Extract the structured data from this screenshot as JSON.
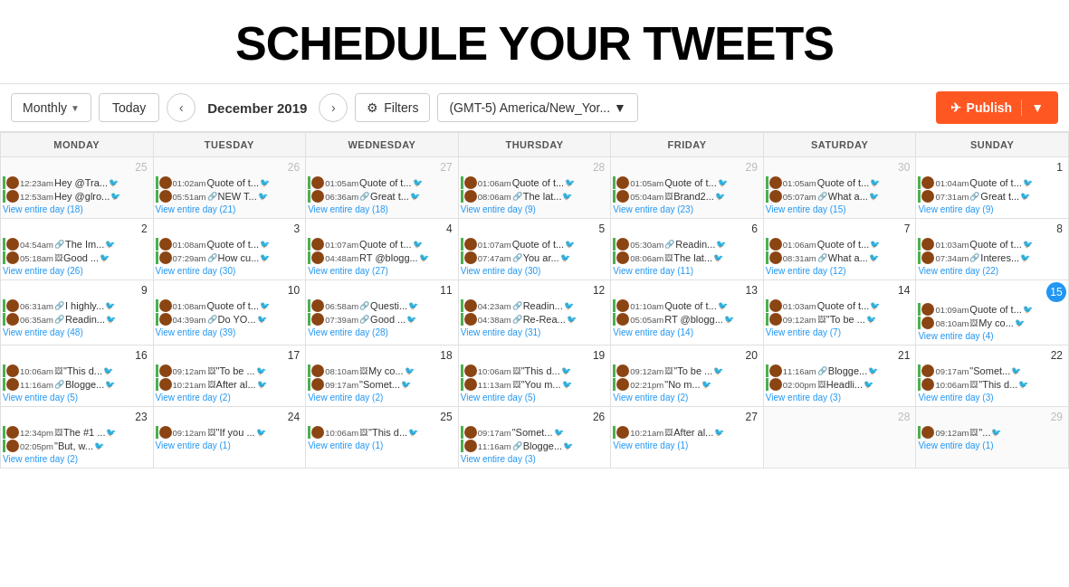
{
  "title": "SCHEDULE YOUR TWEETS",
  "toolbar": {
    "monthly_label": "Monthly",
    "today_label": "Today",
    "prev_icon": "‹",
    "next_icon": "›",
    "date_label": "December 2019",
    "filters_label": "Filters",
    "timezone_label": "(GMT-5) America/New_Yor...",
    "publish_label": "Publish"
  },
  "calendar": {
    "headers": [
      "MONDAY",
      "TUESDAY",
      "WEDNESDAY",
      "THURSDAY",
      "FRIDAY",
      "SATURDAY",
      "SUNDAY"
    ],
    "weeks": [
      {
        "days": [
          {
            "num": "25",
            "other": true,
            "tweets": [
              {
                "time": "12:23am",
                "icon": "",
                "text": "Hey @Tra..."
              },
              {
                "time": "12:53am",
                "icon": "",
                "text": "Hey @glro..."
              }
            ],
            "view": "View entire day (18)"
          },
          {
            "num": "26",
            "other": true,
            "tweets": [
              {
                "time": "01:02am",
                "icon": "",
                "text": "Quote of t..."
              },
              {
                "time": "05:51am",
                "icon": "🔗",
                "text": "NEW T..."
              }
            ],
            "view": "View entire day (21)"
          },
          {
            "num": "27",
            "other": true,
            "tweets": [
              {
                "time": "01:05am",
                "icon": "",
                "text": "Quote of t..."
              },
              {
                "time": "06:36am",
                "icon": "🔗",
                "text": "Great t..."
              }
            ],
            "view": "View entire day (18)"
          },
          {
            "num": "28",
            "other": true,
            "tweets": [
              {
                "time": "01:06am",
                "icon": "",
                "text": "Quote of t..."
              },
              {
                "time": "08:06am",
                "icon": "🔗",
                "text": "The lat..."
              }
            ],
            "view": "View entire day (9)"
          },
          {
            "num": "29",
            "other": true,
            "tweets": [
              {
                "time": "01:05am",
                "icon": "",
                "text": "Quote of t..."
              },
              {
                "time": "05:04am",
                "icon": "🖼",
                "text": "Brand2..."
              }
            ],
            "view": "View entire day (23)"
          },
          {
            "num": "30",
            "other": true,
            "tweets": [
              {
                "time": "01:05am",
                "icon": "",
                "text": "Quote of t..."
              },
              {
                "time": "05:07am",
                "icon": "🔗",
                "text": "What a..."
              }
            ],
            "view": "View entire day (15)"
          },
          {
            "num": "1",
            "other": false,
            "tweets": [
              {
                "time": "01:04am",
                "icon": "",
                "text": "Quote of t..."
              },
              {
                "time": "07:31am",
                "icon": "🔗",
                "text": "Great t..."
              }
            ],
            "view": "View entire day (9)"
          }
        ]
      },
      {
        "days": [
          {
            "num": "2",
            "other": false,
            "tweets": [
              {
                "time": "04:54am",
                "icon": "🔗",
                "text": "The Im..."
              },
              {
                "time": "05:18am",
                "icon": "🖼",
                "text": "Good ..."
              }
            ],
            "view": "View entire day (26)"
          },
          {
            "num": "3",
            "other": false,
            "tweets": [
              {
                "time": "01:08am",
                "icon": "",
                "text": "Quote of t..."
              },
              {
                "time": "07:29am",
                "icon": "🔗",
                "text": "How cu..."
              }
            ],
            "view": "View entire day (30)"
          },
          {
            "num": "4",
            "other": false,
            "tweets": [
              {
                "time": "01:07am",
                "icon": "",
                "text": "Quote of t..."
              },
              {
                "time": "04:48am",
                "icon": "",
                "text": "RT @blogg..."
              }
            ],
            "view": "View entire day (27)"
          },
          {
            "num": "5",
            "other": false,
            "tweets": [
              {
                "time": "01:07am",
                "icon": "",
                "text": "Quote of t..."
              },
              {
                "time": "07:47am",
                "icon": "🔗",
                "text": "You ar..."
              }
            ],
            "view": "View entire day (30)"
          },
          {
            "num": "6",
            "other": false,
            "tweets": [
              {
                "time": "05:30am",
                "icon": "🔗",
                "text": "Readin..."
              },
              {
                "time": "08:06am",
                "icon": "🖼",
                "text": "The lat..."
              }
            ],
            "view": "View entire day (11)"
          },
          {
            "num": "7",
            "other": false,
            "tweets": [
              {
                "time": "01:06am",
                "icon": "",
                "text": "Quote of t..."
              },
              {
                "time": "08:31am",
                "icon": "🔗",
                "text": "What a..."
              }
            ],
            "view": "View entire day (12)"
          },
          {
            "num": "8",
            "other": false,
            "tweets": [
              {
                "time": "01:03am",
                "icon": "",
                "text": "Quote of t..."
              },
              {
                "time": "07:34am",
                "icon": "🔗",
                "text": "Interes..."
              }
            ],
            "view": "View entire day (22)"
          }
        ]
      },
      {
        "days": [
          {
            "num": "9",
            "other": false,
            "tweets": [
              {
                "time": "06:31am",
                "icon": "🔗",
                "text": "I highly..."
              },
              {
                "time": "06:35am",
                "icon": "🔗",
                "text": "Readin..."
              }
            ],
            "view": "View entire day (48)"
          },
          {
            "num": "10",
            "other": false,
            "tweets": [
              {
                "time": "01:08am",
                "icon": "",
                "text": "Quote of t..."
              },
              {
                "time": "04:39am",
                "icon": "🔗",
                "text": "Do YO..."
              }
            ],
            "view": "View entire day (39)"
          },
          {
            "num": "11",
            "other": false,
            "tweets": [
              {
                "time": "06:58am",
                "icon": "🔗",
                "text": "Questi..."
              },
              {
                "time": "07:39am",
                "icon": "🔗",
                "text": "Good ..."
              }
            ],
            "view": "View entire day (28)"
          },
          {
            "num": "12",
            "other": false,
            "tweets": [
              {
                "time": "04:23am",
                "icon": "🔗",
                "text": "Readin..."
              },
              {
                "time": "04:38am",
                "icon": "🔗",
                "text": "Re-Rea..."
              }
            ],
            "view": "View entire day (31)"
          },
          {
            "num": "13",
            "other": false,
            "tweets": [
              {
                "time": "01:10am",
                "icon": "",
                "text": "Quote of t..."
              },
              {
                "time": "05:05am",
                "icon": "",
                "text": "RT @blogg..."
              }
            ],
            "view": "View entire day (14)"
          },
          {
            "num": "14",
            "other": false,
            "tweets": [
              {
                "time": "01:03am",
                "icon": "",
                "text": "Quote of t..."
              },
              {
                "time": "09:12am",
                "icon": "🖼",
                "text": "\"To be ..."
              }
            ],
            "view": "View entire day (7)"
          },
          {
            "num": "15",
            "today": true,
            "other": false,
            "tweets": [
              {
                "time": "01:09am",
                "icon": "",
                "text": "Quote of t..."
              },
              {
                "time": "08:10am",
                "icon": "🖼",
                "text": "My co..."
              }
            ],
            "view": "View entire day (4)"
          }
        ]
      },
      {
        "days": [
          {
            "num": "16",
            "other": false,
            "tweets": [
              {
                "time": "10:06am",
                "icon": "🖼",
                "text": "\"This d..."
              },
              {
                "time": "11:16am",
                "icon": "🔗",
                "text": "Blogge..."
              }
            ],
            "view": "View entire day (5)"
          },
          {
            "num": "17",
            "other": false,
            "tweets": [
              {
                "time": "09:12am",
                "icon": "🖼",
                "text": "\"To be ..."
              },
              {
                "time": "10:21am",
                "icon": "🖼",
                "text": "After al..."
              }
            ],
            "view": "View entire day (2)"
          },
          {
            "num": "18",
            "other": false,
            "tweets": [
              {
                "time": "08:10am",
                "icon": "🖼",
                "text": "My co..."
              },
              {
                "time": "09:17am",
                "icon": "",
                "text": "\"Somet..."
              }
            ],
            "view": "View entire day (2)"
          },
          {
            "num": "19",
            "other": false,
            "tweets": [
              {
                "time": "10:06am",
                "icon": "🖼",
                "text": "\"This d..."
              },
              {
                "time": "11:13am",
                "icon": "🖼",
                "text": "\"You m..."
              }
            ],
            "view": "View entire day (5)"
          },
          {
            "num": "20",
            "other": false,
            "tweets": [
              {
                "time": "09:12am",
                "icon": "🖼",
                "text": "\"To be ..."
              },
              {
                "time": "02:21pm",
                "icon": "",
                "text": "\"No m..."
              }
            ],
            "view": "View entire day (2)"
          },
          {
            "num": "21",
            "other": false,
            "tweets": [
              {
                "time": "11:16am",
                "icon": "🔗",
                "text": "Blogge..."
              },
              {
                "time": "02:00pm",
                "icon": "🖼",
                "text": "Headli..."
              }
            ],
            "view": "View entire day (3)"
          },
          {
            "num": "22",
            "other": false,
            "tweets": [
              {
                "time": "09:17am",
                "icon": "",
                "text": "\"Somet..."
              },
              {
                "time": "10:06am",
                "icon": "🖼",
                "text": "\"This d..."
              }
            ],
            "view": "View entire day (3)"
          }
        ]
      },
      {
        "days": [
          {
            "num": "23",
            "other": false,
            "tweets": [
              {
                "time": "12:34pm",
                "icon": "🖼",
                "text": "The #1 ..."
              },
              {
                "time": "02:05pm",
                "icon": "",
                "text": "\"But, w..."
              }
            ],
            "view": "View entire day (2)"
          },
          {
            "num": "24",
            "other": false,
            "tweets": [
              {
                "time": "09:12am",
                "icon": "🖼",
                "text": "\"If you ..."
              }
            ],
            "view": "View entire day (1)"
          },
          {
            "num": "25",
            "other": false,
            "tweets": [
              {
                "time": "10:06am",
                "icon": "🖼",
                "text": "\"This d..."
              }
            ],
            "view": "View entire day (1)"
          },
          {
            "num": "26",
            "other": false,
            "tweets": [
              {
                "time": "09:17am",
                "icon": "",
                "text": "\"Somet..."
              },
              {
                "time": "11:16am",
                "icon": "🔗",
                "text": "Blogge..."
              }
            ],
            "view": "View entire day (3)"
          },
          {
            "num": "27",
            "other": false,
            "tweets": [
              {
                "time": "10:21am",
                "icon": "🖼",
                "text": "After al..."
              }
            ],
            "view": "View entire day (1)"
          },
          {
            "num": "28",
            "other": true,
            "tweets": [],
            "view": ""
          },
          {
            "num": "29",
            "other": true,
            "tweets": [
              {
                "time": "09:12am",
                "icon": "🖼",
                "text": "\"..."
              }
            ],
            "view": "View entire day (1)"
          }
        ]
      }
    ]
  }
}
